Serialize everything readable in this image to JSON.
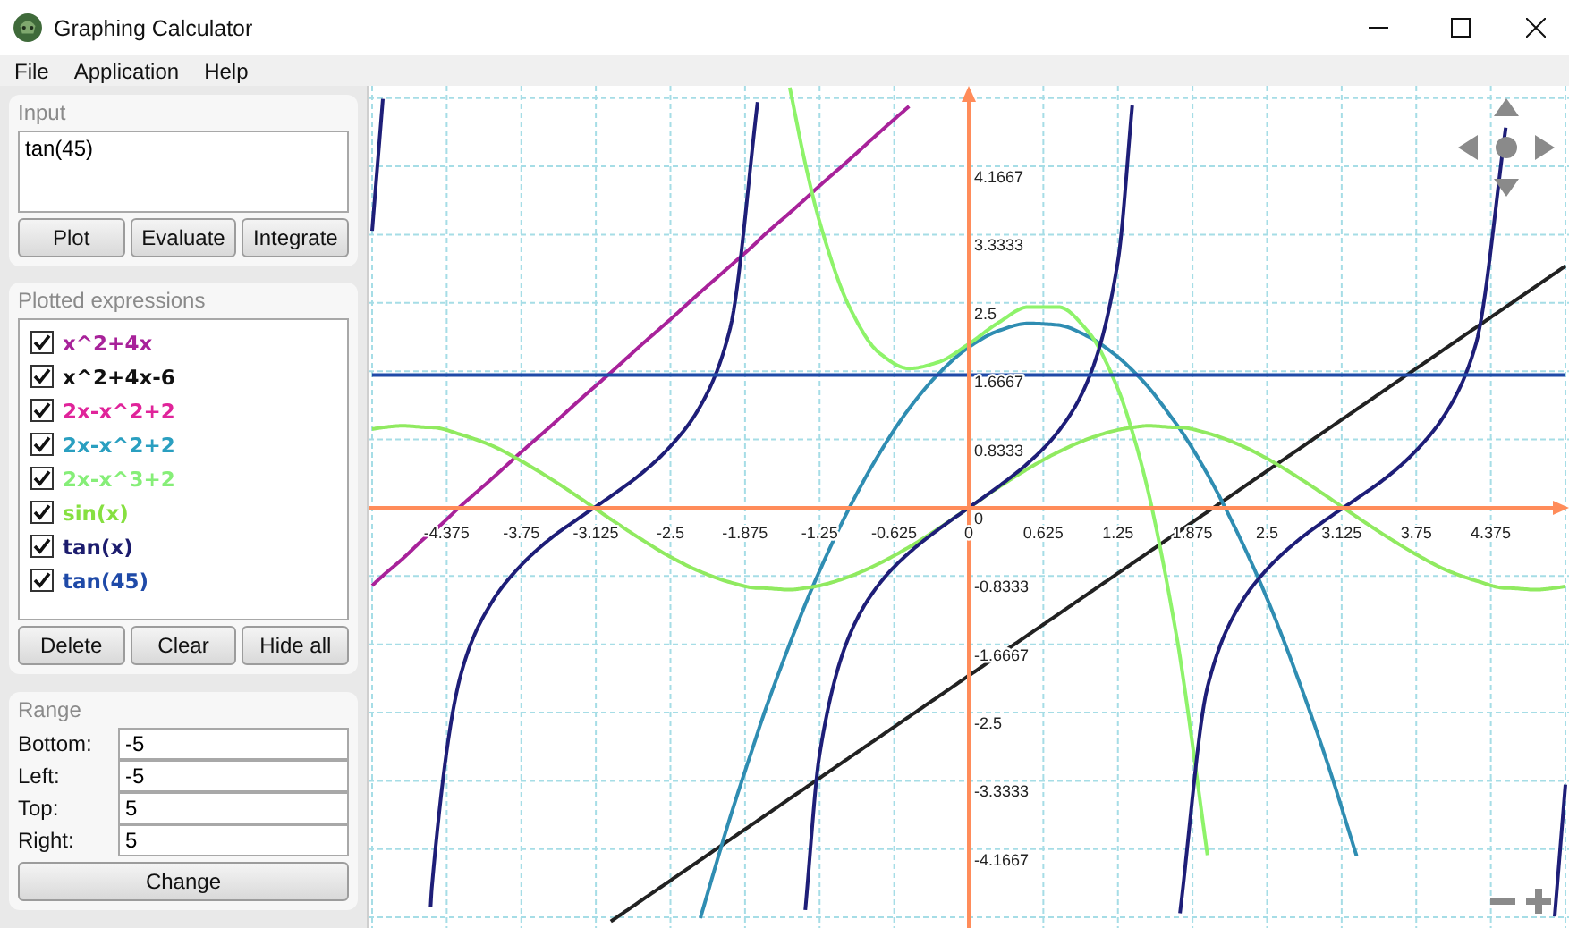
{
  "window": {
    "title": "Graphing Calculator"
  },
  "menu": [
    "File",
    "Application",
    "Help"
  ],
  "input": {
    "label": "Input",
    "value": "tan(45)",
    "buttons": [
      "Plot",
      "Evaluate",
      "Integrate"
    ]
  },
  "plotted": {
    "label": "Plotted expressions",
    "items": [
      {
        "expression": "x^2+4x",
        "checked": true,
        "color": "#a8229a"
      },
      {
        "expression": "x^2+4x-6",
        "checked": true,
        "color": "#111111"
      },
      {
        "expression": "2x-x^2+2",
        "checked": true,
        "color": "#e0249a"
      },
      {
        "expression": "2x-x^2+2",
        "checked": true,
        "color": "#2a9fc0"
      },
      {
        "expression": "2x-x^3+2",
        "checked": true,
        "color": "#86ee78"
      },
      {
        "expression": "sin(x)",
        "checked": true,
        "color": "#86e040"
      },
      {
        "expression": "tan(x)",
        "checked": true,
        "color": "#1c1c6e"
      },
      {
        "expression": "tan(45)",
        "checked": true,
        "color": "#1f4aa8"
      }
    ],
    "buttons": [
      "Delete",
      "Clear",
      "Hide all"
    ]
  },
  "range": {
    "label": "Range",
    "fields": [
      {
        "label": "Bottom:",
        "value": "-5"
      },
      {
        "label": "Left:",
        "value": "-5"
      },
      {
        "label": "Top:",
        "value": "5"
      },
      {
        "label": "Right:",
        "value": "5"
      }
    ],
    "button": "Change"
  },
  "plot": {
    "chart_data": {
      "type": "line",
      "grid": true,
      "x": [
        -5,
        -4.91,
        -4.75,
        -4.51,
        -4.5,
        -4.25,
        -4,
        -3.75,
        -3.5,
        -3.25,
        -3,
        -2.75,
        -2.5,
        -2.25,
        -2,
        -1.77,
        -1.75,
        -1.5,
        -1.37,
        -1.25,
        -1,
        -0.75,
        -0.5,
        -0.25,
        0,
        0.25,
        0.5,
        0.75,
        1,
        1.25,
        1.37,
        1.5,
        1.75,
        1.77,
        2,
        2.25,
        2.5,
        2.75,
        3,
        3.25,
        3.5,
        3.75,
        4,
        4.25,
        4.5,
        4.51,
        4.75,
        4.91,
        5
      ],
      "series": [
        {
          "color": "#a8229a",
          "values": [
            -0.95,
            -0.83,
            -0.63,
            -0.31,
            -0.3,
            0.03,
            0.35,
            0.68,
            1,
            1.33,
            1.65,
            1.98,
            2.3,
            2.63,
            2.95,
            3.25,
            3.28,
            3.6,
            3.77,
            3.93,
            4.25,
            4.58,
            4.9,
            null,
            null,
            null,
            null,
            null,
            null,
            null,
            null,
            null,
            null,
            null,
            null,
            null,
            null,
            null,
            null,
            null,
            null,
            null,
            null,
            null,
            null,
            null,
            null,
            null,
            null
          ]
        },
        {
          "color": "#222222",
          "values": [
            null,
            null,
            null,
            null,
            null,
            null,
            null,
            null,
            null,
            null,
            -5.05,
            -4.8,
            -4.55,
            -4.3,
            -4.05,
            -3.82,
            -3.8,
            -3.55,
            -3.42,
            -3.3,
            -3.05,
            -2.8,
            -2.55,
            -2.3,
            -2.05,
            -1.8,
            -1.55,
            -1.3,
            -1.05,
            -0.8,
            -0.68,
            -0.55,
            -0.3,
            -0.28,
            -0.05,
            0.2,
            0.45,
            0.7,
            0.95,
            1.2,
            1.45,
            1.7,
            1.95,
            2.2,
            2.45,
            2.46,
            2.7,
            2.86,
            2.95
          ]
        },
        {
          "color": "#2f8db2",
          "values": [
            null,
            null,
            null,
            null,
            null,
            null,
            null,
            null,
            null,
            null,
            null,
            null,
            null,
            -5.01,
            -3.78,
            -2.75,
            -2.66,
            -1.66,
            -1.18,
            -0.77,
            0,
            0.66,
            1.21,
            1.64,
            1.96,
            2.16,
            2.25,
            2.23,
            2.09,
            1.84,
            1.68,
            1.48,
            1,
            0.96,
            0.41,
            -0.3,
            -1.11,
            -2.05,
            -3.09,
            -4.25,
            null,
            null,
            null,
            null,
            null,
            null,
            null,
            null,
            null
          ]
        },
        {
          "color": "#8ef36a",
          "values": [
            null,
            null,
            null,
            null,
            null,
            null,
            null,
            null,
            null,
            null,
            null,
            null,
            null,
            null,
            null,
            null,
            null,
            5.13,
            4.2,
            3.49,
            2.45,
            1.89,
            1.7,
            1.78,
            2,
            2.26,
            2.45,
            2.45,
            2.15,
            1.45,
            0.93,
            0.22,
            -1.64,
            -1.82,
            -4.24,
            null,
            null,
            null,
            null,
            null,
            null,
            null,
            null,
            null,
            null,
            null,
            null,
            null,
            null
          ]
        },
        {
          "color": "#90ea60",
          "values": [
            0.96,
            0.98,
            1,
            0.98,
            0.98,
            0.89,
            0.76,
            0.57,
            0.35,
            0.11,
            -0.14,
            -0.38,
            -0.6,
            -0.78,
            -0.91,
            -0.98,
            -0.98,
            -1,
            -0.98,
            -0.95,
            -0.84,
            -0.68,
            -0.48,
            -0.25,
            0,
            0.25,
            0.48,
            0.68,
            0.84,
            0.95,
            0.98,
            1,
            0.98,
            0.98,
            0.91,
            0.78,
            0.6,
            0.38,
            0.14,
            -0.11,
            -0.35,
            -0.57,
            -0.76,
            -0.89,
            -0.98,
            -0.98,
            -1,
            -0.98,
            -0.96
          ]
        },
        {
          "color": "#1e1e78",
          "values": [
            3.38,
            4.99,
            null,
            -4.87,
            -4.64,
            -2,
            -1.16,
            -0.7,
            -0.37,
            -0.11,
            0.14,
            0.41,
            0.75,
            1.24,
            2.19,
            4.95,
            null,
            null,
            -4.91,
            -3.01,
            -1.56,
            -0.93,
            -0.55,
            -0.26,
            0,
            0.26,
            0.55,
            0.93,
            1.56,
            3.01,
            4.91,
            null,
            null,
            -4.95,
            -2.19,
            -1.24,
            -0.75,
            -0.41,
            -0.14,
            0.11,
            0.37,
            0.7,
            1.16,
            2,
            4.64,
            null,
            null,
            -4.99,
            -3.38
          ]
        },
        {
          "color": "#1f4aa8",
          "values": [
            1.62,
            1.62,
            1.62,
            1.62,
            1.62,
            1.62,
            1.62,
            1.62,
            1.62,
            1.62,
            1.62,
            1.62,
            1.62,
            1.62,
            1.62,
            1.62,
            1.62,
            1.62,
            1.62,
            1.62,
            1.62,
            1.62,
            1.62,
            1.62,
            1.62,
            1.62,
            1.62,
            1.62,
            1.62,
            1.62,
            1.62,
            1.62,
            1.62,
            1.62,
            1.62,
            1.62,
            1.62,
            1.62,
            1.62,
            1.62,
            1.62,
            1.62,
            1.62,
            1.62,
            1.62,
            1.62,
            1.62,
            1.62,
            1.62
          ]
        }
      ],
      "xlim": [
        -5.03,
        5.03
      ],
      "ylim": [
        -5.13,
        5.15
      ],
      "xticks": [
        -4.375,
        -3.75,
        -3.125,
        -2.5,
        -1.875,
        -1.25,
        -0.625,
        0,
        0.625,
        1.25,
        1.875,
        2.5,
        3.125,
        3.75,
        4.375
      ],
      "yticks": [
        4.1667,
        3.3333,
        2.5,
        1.6667,
        0.8333,
        0,
        -0.8333,
        -1.6667,
        -2.5,
        -3.3333,
        -4.1667
      ]
    }
  }
}
